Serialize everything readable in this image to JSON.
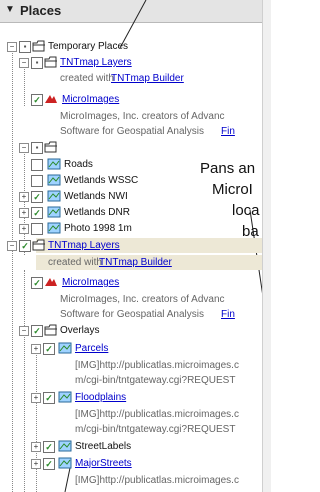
{
  "panel": {
    "title": "Places"
  },
  "tree": {
    "root_label": "Temporary Places",
    "group1": {
      "label": "TNTmap Layers",
      "created_prefix": "created with",
      "created_link": "TNTmap Builder",
      "microimages": {
        "label": "MicroImages",
        "desc1": "MicroImages, Inc. creators of Advanc",
        "desc2_prefix": "Software for Geospatial Analysis",
        "desc2_link": "Fin"
      }
    },
    "folder_items": [
      "Roads",
      "Wetlands WSSC",
      "Wetlands NWI",
      "Wetlands DNR",
      "Photo 1998 1m"
    ],
    "group2": {
      "label": "TNTmap Layers",
      "created_prefix": "created with",
      "created_link": "TNTmap Builder",
      "microimages": {
        "label": "MicroImages",
        "desc1": "MicroImages, Inc. creators of Advanc",
        "desc2_prefix": "Software for Geospatial Analysis",
        "desc2_link": "Fin"
      },
      "overlays_label": "Overlays",
      "parcels": {
        "label": "Parcels",
        "url1": "[IMG]http://publicatlas.microimages.c",
        "url2": "m/cgi-bin/tntgateway.cgi?REQUEST"
      },
      "floodplains": {
        "label": "Floodplains",
        "url1": "[IMG]http://publicatlas.microimages.c",
        "url2": "m/cgi-bin/tntgateway.cgi?REQUEST"
      },
      "streetlabels_label": "StreetLabels",
      "majorstreets": {
        "label": "MajorStreets",
        "url1": "[IMG]http://publicatlas.microimages.c"
      }
    }
  },
  "overlay_text": [
    "Pans an",
    "MicroI",
    "loca",
    "ba"
  ],
  "colors": {
    "link": "#0000cc",
    "highlight": "#ede8d6",
    "check": "#2b8a2b"
  }
}
